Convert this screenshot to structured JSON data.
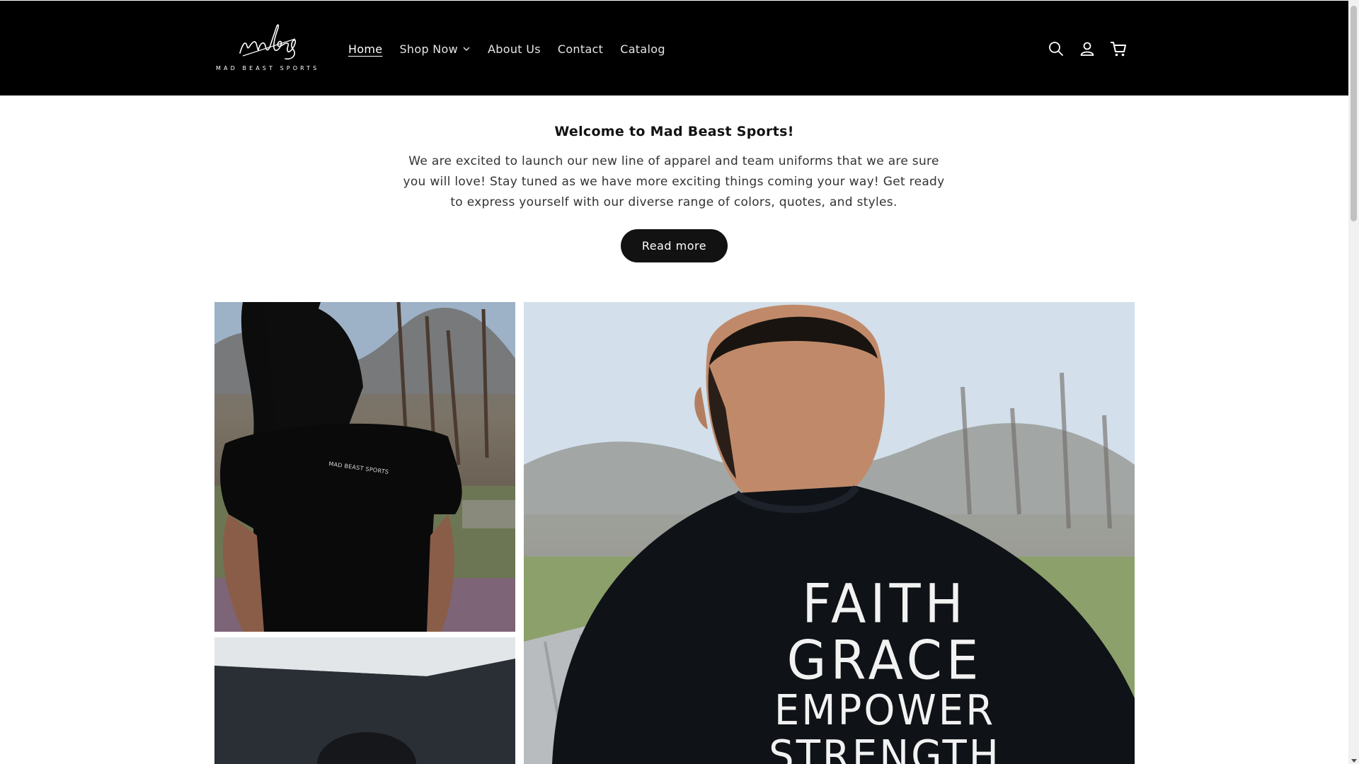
{
  "brand": {
    "logo_script": "mbs",
    "logo_sub": "MAD BEAST SPORTS"
  },
  "nav": {
    "items": [
      {
        "label": "Home",
        "active": true
      },
      {
        "label": "Shop Now",
        "has_dropdown": true
      },
      {
        "label": "About Us"
      },
      {
        "label": "Contact"
      },
      {
        "label": "Catalog"
      }
    ]
  },
  "header_icons": [
    "search-icon",
    "account-icon",
    "cart-icon"
  ],
  "intro": {
    "title": "Welcome to Mad Beast Sports!",
    "text": "We are excited to launch our new line of apparel and team uniforms that we are sure you will love! Stay tuned as we have more exciting things coming your way! Get ready to express yourself with our diverse range of colors, quotes, and styles.",
    "button_label": "Read more"
  },
  "collage": {
    "woman_shirt_print": "MAD BEAST SPORTS",
    "man_shirt_words": [
      "FAITH",
      "GRACE",
      "EMPOWER",
      "STRENGTH"
    ]
  },
  "colors": {
    "header_bg": "#000000",
    "button_bg": "#121212",
    "page_bg": "#ffffff"
  }
}
